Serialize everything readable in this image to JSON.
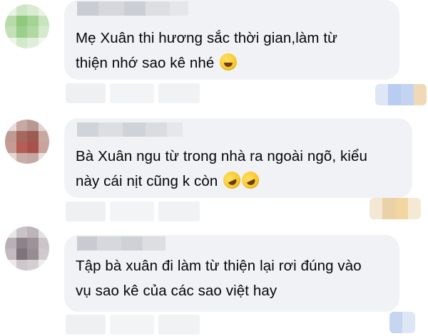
{
  "comments": [
    {
      "avatar_icon": "blurred-avatar",
      "text_line1": "Mẹ Xuân thi hương sắc thời gian,làm từ",
      "text_line2": "thiện nhớ sao kê nhé",
      "emoji_icons": [
        "laughing-tears-emoji"
      ]
    },
    {
      "avatar_icon": "blurred-avatar",
      "text_line1": "Bà Xuân ngu từ trong nhà ra ngoài ngõ, kiểu",
      "text_line2": "này cái nịt cũng k còn",
      "emoji_icons": [
        "rolling-laughing-emoji",
        "rolling-laughing-emoji"
      ]
    },
    {
      "avatar_icon": "blurred-avatar",
      "text_line1": "Tập bà xuân đi làm từ thiện lại rơi đúng vào",
      "text_line2": "vụ sao kê của các sao việt hay",
      "emoji_icons": []
    }
  ],
  "colors": {
    "bubble": "#f0f2f5",
    "text": "#050505",
    "blur_gray": "#d8dadf"
  }
}
